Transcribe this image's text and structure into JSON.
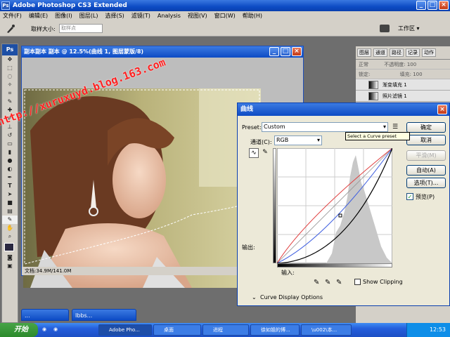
{
  "app": {
    "title": "Adobe Photoshop CS3 Extended",
    "logo": "Ps"
  },
  "menu": [
    "文件(F)",
    "编辑(E)",
    "图像(I)",
    "图层(L)",
    "选择(S)",
    "滤镜(T)",
    "Analysis",
    "视图(V)",
    "窗口(W)",
    "帮助(H)"
  ],
  "options": {
    "sample_size_label": "取样大小:",
    "sample_size_value": "取样点",
    "workspace": "工作区"
  },
  "document": {
    "title": "副本副本 副本 @ 12.5%(曲线 1, 图层蒙版/8)",
    "status": "文档:34.9M/141.0M"
  },
  "panels": {
    "tabs": [
      "图层",
      "通道",
      "路径",
      "记录",
      "动作"
    ],
    "blend_mode": "正常",
    "opacity_label": "不透明度:",
    "opacity_value": "100",
    "lock_label": "锁定:",
    "fill_label": "填充:",
    "fill_value": "100",
    "layers": [
      "渐变填充 1",
      "照片滤镜 1"
    ]
  },
  "curves": {
    "title": "曲线",
    "preset_label": "Preset:",
    "preset_value": "Custom",
    "channel_label": "通道(C):",
    "channel_value": "RGB",
    "output_label": "输出:",
    "input_label": "输入:",
    "buttons": {
      "ok": "确定",
      "cancel": "取消",
      "smooth": "平滑(M)",
      "auto": "自动(A)",
      "options": "选项(T)..."
    },
    "preview_label": "预览(P)",
    "preview_checked": true,
    "show_clipping_label": "Show Clipping",
    "display_options_label": "Curve Display Options",
    "tooltip": "Select a Curve preset"
  },
  "minimized_windows": [
    "...",
    "Ibbs..."
  ],
  "taskbar": {
    "start": "开始",
    "tasks": [
      "Adobe Pho...",
      "桌面",
      "进程",
      "徐如姐的博...",
      "\\u002\\本..."
    ],
    "clock": "12:53"
  },
  "watermark": "http://xuruxuyd.blog.163.com"
}
